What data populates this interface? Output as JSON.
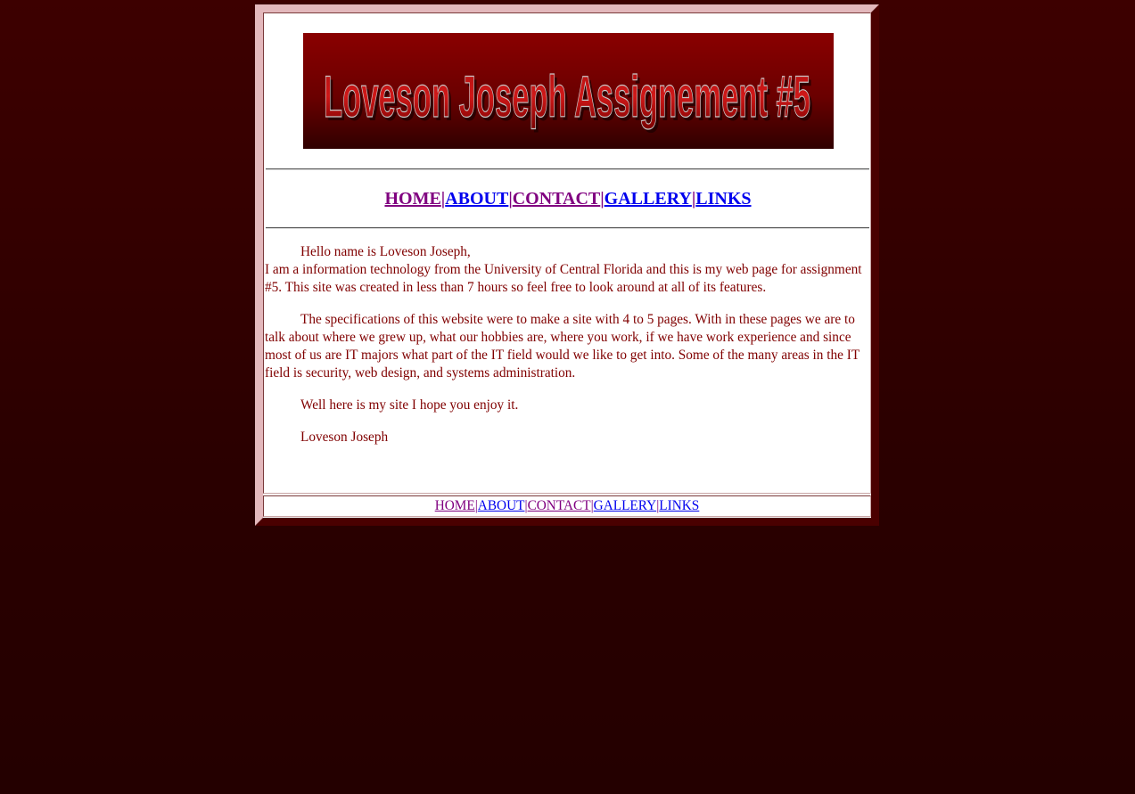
{
  "banner": {
    "text": "Loveson Joseph Assignement #5"
  },
  "nav": {
    "items": [
      {
        "label": "HOME",
        "visited": true
      },
      {
        "label": "ABOUT",
        "visited": false
      },
      {
        "label": "CONTACT",
        "visited": true
      },
      {
        "label": "GALLERY",
        "visited": false
      },
      {
        "label": "LINKS",
        "visited": false
      }
    ],
    "separator": "|"
  },
  "content": {
    "p1_line1": "Hello name is Loveson Joseph,",
    "p1_rest": "I am a information technology from the University of Central Florida and this is my web page for assignment #5. This site was created in less than 7 hours so feel free to look around at all of its features.",
    "p2": "The specifications of this website were to make a site with 4 to 5 pages. With in these pages we are to talk about where we grew up, what our hobbies are, where you work, if we have work experience and since most of us are IT majors what part of the IT field would we like to get into. Some of the many areas in the IT field is security, web design, and systems administration.",
    "p3": "Well here is my site I hope you enjoy it.",
    "p4": "Loveson Joseph"
  },
  "colors": {
    "background": "#3d0000",
    "text": "#800000",
    "visited_link": "#800080",
    "link": "#0000ee"
  }
}
